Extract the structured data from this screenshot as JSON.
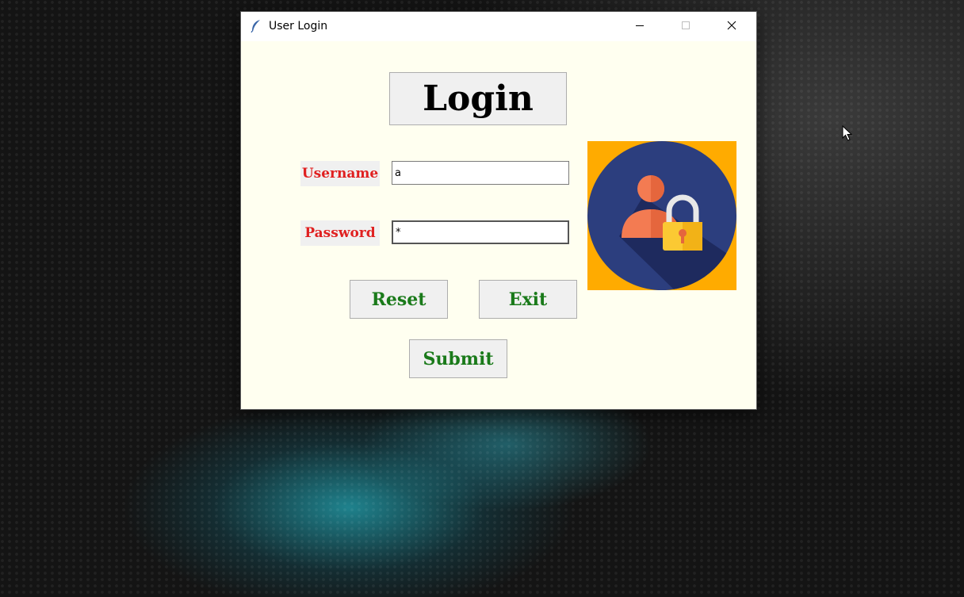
{
  "window": {
    "title": "User Login",
    "controls": {
      "minimize": "minimize-icon",
      "maximize": "maximize-icon",
      "close": "close-icon"
    }
  },
  "form": {
    "heading": "Login",
    "username": {
      "label": "Username",
      "value": "a"
    },
    "password": {
      "label": "Password",
      "value": "*"
    },
    "buttons": {
      "reset": "Reset",
      "exit": "Exit",
      "submit": "Submit"
    }
  },
  "icons": {
    "app": "feather-icon",
    "illustration": "user-lock-icon",
    "cursor": "mouse-pointer-icon"
  },
  "colors": {
    "window_bg": "#fffff0",
    "label_text": "#e02020",
    "button_text": "#1a7a1a",
    "illustration_bg": "#ffab00",
    "illustration_circle": "#2c3e7e"
  }
}
